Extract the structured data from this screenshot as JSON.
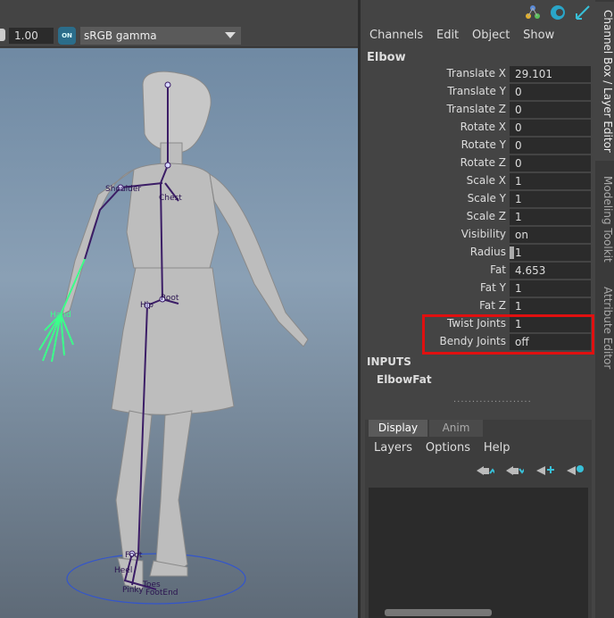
{
  "viewport_toolbar": {
    "gamma_value": "1.00",
    "on_label": "ON",
    "color_space": "sRGB gamma"
  },
  "skeleton_labels": {
    "shoulder": "Shoulder",
    "chest": "Chest",
    "root": "Root",
    "hip": "Hip",
    "hand": "Hand",
    "foot": "Foot",
    "heel": "Heel",
    "pinky": "Pinky",
    "toes": "Toes",
    "footend": "FootEnd"
  },
  "channel_box": {
    "menu": [
      "Channels",
      "Edit",
      "Object",
      "Show"
    ],
    "node_name": "Elbow",
    "attributes": [
      {
        "label": "Translate X",
        "value": "29.101"
      },
      {
        "label": "Translate Y",
        "value": "0"
      },
      {
        "label": "Translate Z",
        "value": "0"
      },
      {
        "label": "Rotate X",
        "value": "0"
      },
      {
        "label": "Rotate Y",
        "value": "0"
      },
      {
        "label": "Rotate Z",
        "value": "0"
      },
      {
        "label": "Scale X",
        "value": "1"
      },
      {
        "label": "Scale Y",
        "value": "1"
      },
      {
        "label": "Scale Z",
        "value": "1"
      },
      {
        "label": "Visibility",
        "value": "on"
      },
      {
        "label": "Radius",
        "value": "1"
      },
      {
        "label": "Fat",
        "value": "4.653"
      },
      {
        "label": "Fat Y",
        "value": "1"
      },
      {
        "label": "Fat Z",
        "value": "1"
      },
      {
        "label": "Twist Joints",
        "value": "1"
      },
      {
        "label": "Bendy Joints",
        "value": "off"
      }
    ],
    "inputs_heading": "INPUTS",
    "input_node": "ElbowFat"
  },
  "layer_editor": {
    "tabs": [
      "Display",
      "Anim"
    ],
    "menu": [
      "Layers",
      "Options",
      "Help"
    ]
  },
  "side_tabs": [
    "Channel Box / Layer Editor",
    "Modeling Toolkit",
    "Attribute Editor"
  ],
  "colors": {
    "highlight_box": "#e01010",
    "selected_chain": "#3cff8a",
    "skeleton": "#3b1d66"
  }
}
